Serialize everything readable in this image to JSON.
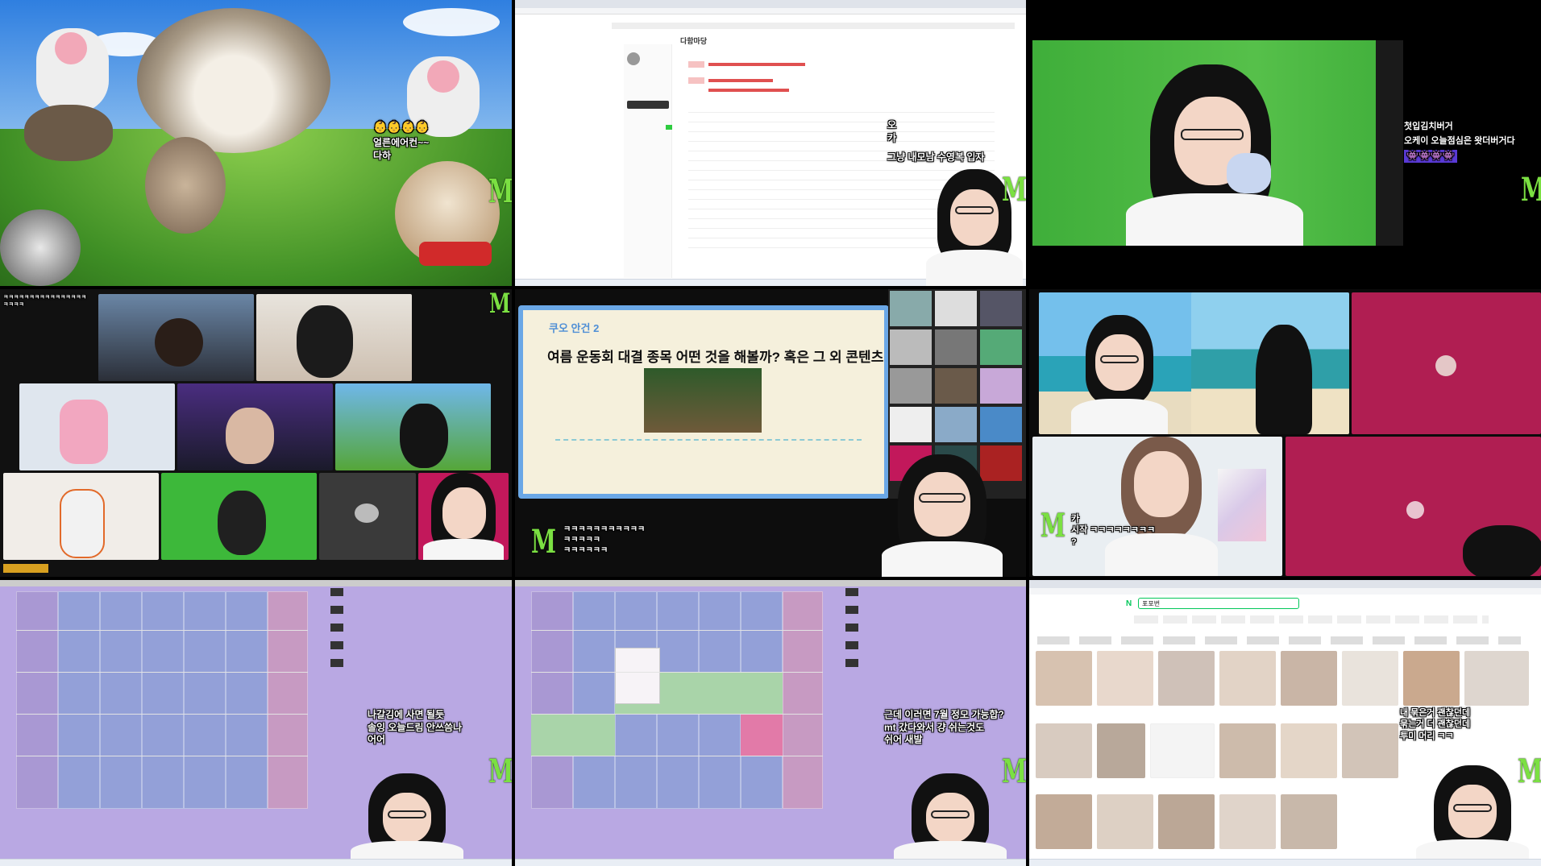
{
  "brand": {
    "watermark": "M",
    "watermark_color": "#7be042"
  },
  "cells": {
    "c1": {
      "emotes": "👶👶👶👶",
      "caption": "얼른에어컨~~\n다하"
    },
    "c2": {
      "board_title": "다함마당",
      "caption_side": "오\n카",
      "caption": "그냥 내모남 수영복 입자"
    },
    "c3": {
      "caption_line1": "첫입김치버거",
      "caption_line2": "오케이 오늘점심은 왓더버거다",
      "emotes": "👾👾👾👾"
    },
    "c4": {
      "chat": "ㅋㅋㅋㅋㅋㅋㅋㅋㅋㅋㅋㅋㅋㅋㅋㅋ\nㅋㅋㅋㅋ"
    },
    "c5": {
      "slide_tag": "쿠오 안건 2",
      "slide_title": "여름 운동회 대결 종목 어떤 것을 해볼까? 혹은 그 외 콘텐츠",
      "chat": "ㅋㅋㅋㅋㅋㅋㅋㅋㅋㅋㅋ\nㅋㅋㅋㅋㅋ\nㅋㅋㅋㅋㅋㅋ"
    },
    "c6": {
      "caption": "카\n시작 ㅋㅋㅋㅋㅋㅋㅋㅋ\n?"
    },
    "c7": {
      "caption": "나갈김에 사면 될듯\n솔잉 오늘드림 안쓰씀나\n어어"
    },
    "c8": {
      "caption": "근데 이러면 7월 정모 가능합?\nmt 갔다와서 걍 쉬는것도\n쉬어 새발"
    },
    "c9": {
      "site_logo": "N",
      "search_query": "포포번",
      "caption": "내 묶은거 괜찮던데\n묶는거 더 괜찮던데\n투미 머리 ㅋㅋ"
    }
  }
}
